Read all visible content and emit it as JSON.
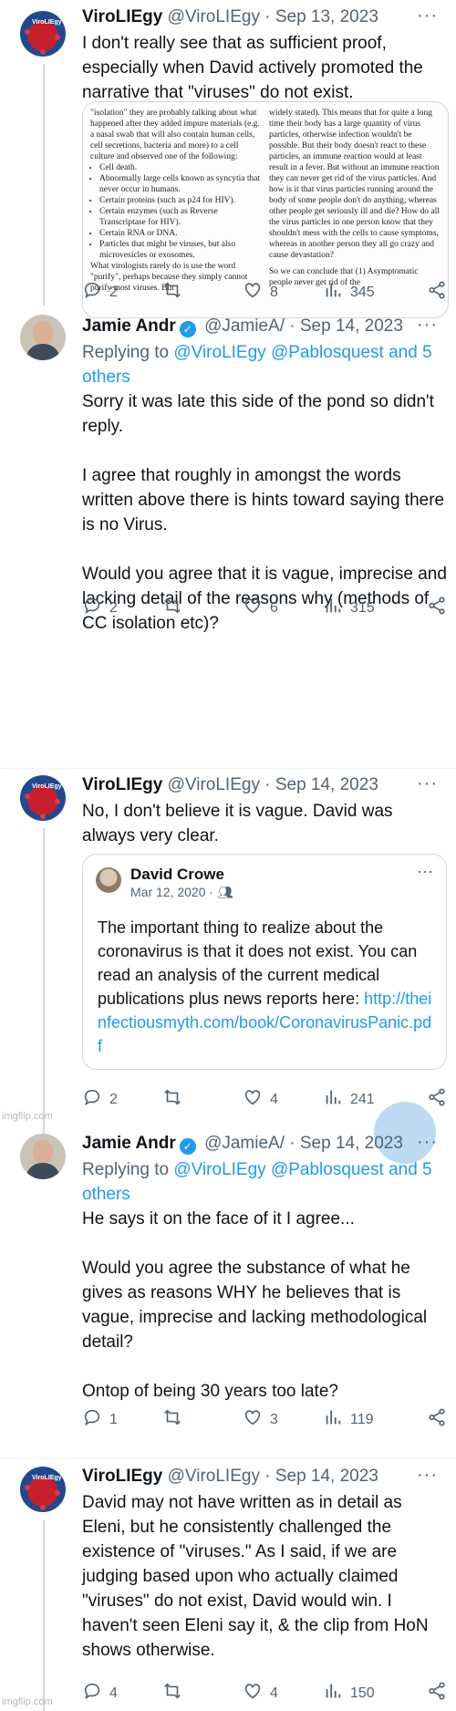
{
  "tweets": [
    {
      "name": "ViroLIEgy",
      "handle": "@ViroLIEgy",
      "date": "· Sep 13, 2023",
      "text": "I don't really see that as sufficient proof, especially when David actively promoted the narrative that \"viruses\" do not exist.",
      "media": {
        "left_lines": [
          "\"isolation\" they are probably talking about what happened after they added impure materials (e.g. a nasal swab that will also contain human cells, cell secretions, bacteria and more) to a cell culture and observed one of the following:"
        ],
        "left_bullets": [
          "Cell death.",
          "Abnormally large cells known as syncytia that never occur in humans.",
          "Certain proteins (such as p24 for HIV).",
          "Certain enzymes (such as Reverse Transcriptase for HIV).",
          "Certain RNA or DNA.",
          "Particles that might be viruses, but also microvesicles or exosomes."
        ],
        "left_tail": "What virologists rarely do is use the word \"purify\", perhaps because they simply cannot purify most viruses. But",
        "right_text": "widely stated). This means that for quite a long time their body has a large quantity of virus particles, otherwise infection wouldn't be possible. But their body doesn't react to these particles, an immune reaction would at least result in a fever. But without an immune reaction they can never get rid of the virus particles. And how is it that virus particles running around the body of some people don't do anything, whereas other people get seriously ill and die? How do all the virus particles in one person know that they shouldn't mess with the cells to cause symptoms, whereas in another person they all go crazy and cause devastation?",
        "right_tail": "So we can conclude that (1) Asymptomatic people never get rid of the"
      },
      "replies": "2",
      "retweets": "",
      "likes": "8",
      "views": "345"
    },
    {
      "name": "Jamie Andr",
      "handle": "@JamieA/",
      "date": "· Sep 14, 2023",
      "replying_label": "Replying to ",
      "replying_users": "@ViroLIEgy @Pablosquest and 5 others",
      "paragraphs": [
        "Sorry it was late this side of the pond so didn't reply.",
        "I agree that roughly in amongst the words written above there is hints toward saying there is no Virus.",
        "Would you agree that it is vague, imprecise and lacking detail of the reasons why (methods of CC isolation etc)?"
      ],
      "replies": "2",
      "retweets": "",
      "likes": "6",
      "views": "315"
    },
    {
      "name": "ViroLIEgy",
      "handle": "@ViroLIEgy",
      "date": "· Sep 14, 2023",
      "text": "No, I don't believe it is vague. David was always very clear.",
      "quote": {
        "name": "David Crowe",
        "date": "Mar 12, 2020 ·",
        "text": "The important thing to realize about the coronavirus is that it does not exist. You can read an analysis of the current medical publications plus news reports here:",
        "link": "http://theinfectiousmyth.com/book/CoronavirusPanic.pdf"
      },
      "replies": "2",
      "retweets": "",
      "likes": "4",
      "views": "241"
    },
    {
      "name": "Jamie Andr",
      "handle": "@JamieA/",
      "date": "· Sep 14, 2023",
      "replying_label": "Replying to ",
      "replying_users": "@ViroLIEgy @Pablosquest and 5 others",
      "paragraphs": [
        "He says it on the face of it I agree...",
        "Would you agree the substance of what he gives as reasons WHY he believes that is vague, imprecise and lacking methodological detail?",
        "Ontop of being 30 years too late?"
      ],
      "replies": "1",
      "retweets": "",
      "likes": "3",
      "views": "119"
    },
    {
      "name": "ViroLIEgy",
      "handle": "@ViroLIEgy",
      "date": "· Sep 14, 2023",
      "text": "David may not have written as in detail as Eleni, but he consistently challenged the existence of \"viruses.\" As I said, if we are judging based upon who actually claimed \"viruses\" do not exist, David would win. I haven't seen Eleni say it, & the clip from HoN shows otherwise.",
      "replies": "4",
      "retweets": "",
      "likes": "4",
      "views": "150"
    }
  ],
  "watermark": "imgflip.com",
  "more_glyph": "···",
  "verified_glyph": "✓",
  "icons": [
    "reply-icon",
    "retweet-icon",
    "like-icon",
    "views-icon",
    "share-icon"
  ],
  "colors": {
    "link": "#1d9bf0",
    "muted": "#536471",
    "text": "#0f1419",
    "verified": "#1d9bf0"
  }
}
